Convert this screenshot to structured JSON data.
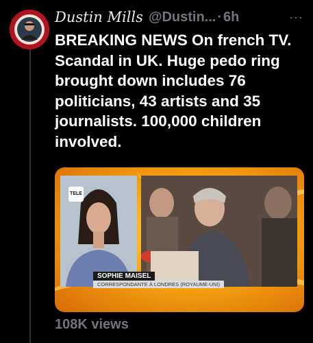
{
  "tweet": {
    "display_name": "Dustin Mills",
    "handle": "@Dustin...",
    "separator": "·",
    "time": "6h",
    "more_icon": "more-horizontal-icon",
    "text": "BREAKING NEWS On french TV. Scandal in UK. Huge pedo ring brought down includes 76 politicians, 43 artists and 35 journalists. 100,000 children involved.",
    "views": "108K views"
  },
  "media": {
    "channel_logo": "TELE",
    "lower_third_name": "SOPHIE MAISEL",
    "lower_third_role": "CORRESPONDANTE À LONDRES (ROYAUME-UNI)"
  },
  "colors": {
    "background": "#000000",
    "text_primary": "#e7e9ea",
    "text_secondary": "#71767b",
    "media_accent": "#f6a512",
    "avatar_ring": "#b3121f"
  }
}
